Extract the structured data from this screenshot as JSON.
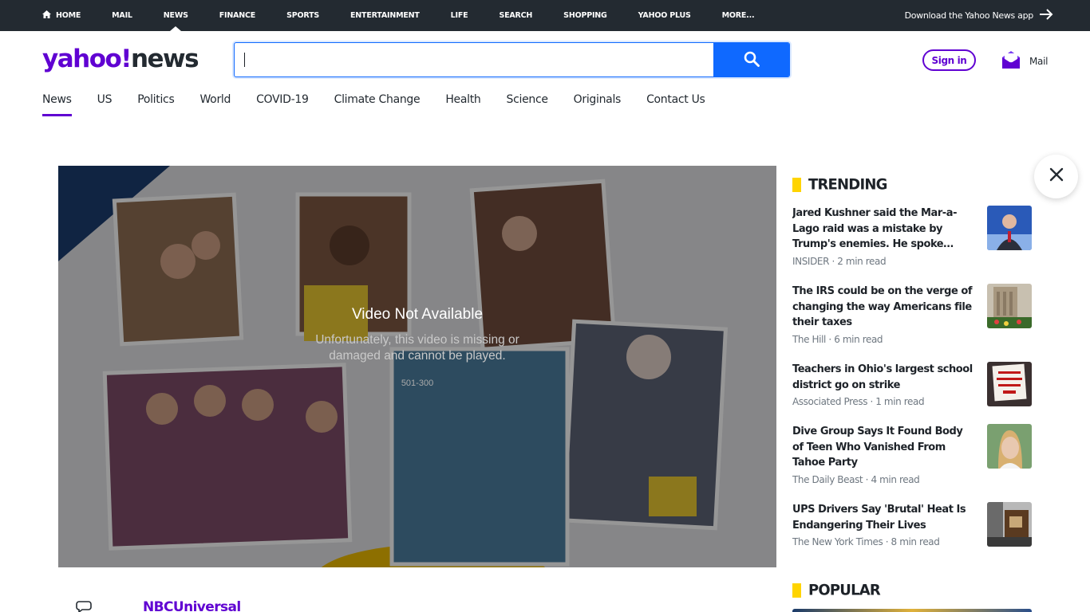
{
  "topnav": {
    "items": [
      "HOME",
      "MAIL",
      "NEWS",
      "FINANCE",
      "SPORTS",
      "ENTERTAINMENT",
      "LIFE",
      "SEARCH",
      "SHOPPING",
      "YAHOO PLUS",
      "MORE..."
    ],
    "active": "NEWS",
    "app_download": "Download the Yahoo News app"
  },
  "header": {
    "logo_yahoo": "yahoo!",
    "logo_news": "news",
    "search_value": "",
    "sign_in": "Sign in",
    "mail": "Mail"
  },
  "subnav": {
    "items": [
      "News",
      "US",
      "Politics",
      "World",
      "COVID-19",
      "Climate Change",
      "Health",
      "Science",
      "Originals",
      "Contact Us"
    ],
    "active": "News"
  },
  "video": {
    "title": "Video Not Available",
    "body": "Unfortunately, this video is missing or damaged and cannot be played.",
    "code": "501-300"
  },
  "provider": "NBCUniversal",
  "trending": {
    "heading": "TRENDING",
    "items": [
      {
        "headline": "Jared Kushner said the Mar-a-Lago raid was a mistake by Trump's enemies. He spoke after his own memoir was released.",
        "meta": "INSIDER · 2 min read"
      },
      {
        "headline": "The IRS could be on the verge of changing the way Americans file their taxes",
        "meta": "The Hill · 6 min read"
      },
      {
        "headline": "Teachers in Ohio's largest school district go on strike",
        "meta": "Associated Press · 1 min read"
      },
      {
        "headline": "Dive Group Says It Found Body of Teen Who Vanished From Tahoe Party",
        "meta": "The Daily Beast · 4 min read"
      },
      {
        "headline": "UPS Drivers Say 'Brutal' Heat Is Endangering Their Lives",
        "meta": "The New York Times · 8 min read"
      }
    ]
  },
  "popular": {
    "heading": "POPULAR"
  },
  "colors": {
    "brand": "#6001d2",
    "accent": "#0f69ff",
    "topbar": "#232a31",
    "highlight": "#ffd400"
  }
}
